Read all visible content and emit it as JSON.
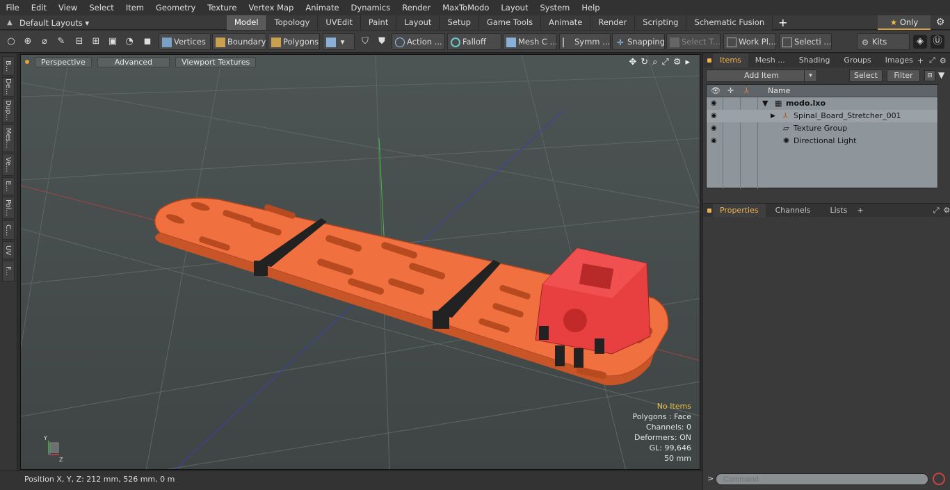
{
  "menu": [
    "File",
    "Edit",
    "View",
    "Select",
    "Item",
    "Geometry",
    "Texture",
    "Vertex Map",
    "Animate",
    "Dynamics",
    "Render",
    "MaxToModo",
    "Layout",
    "System",
    "Help"
  ],
  "layout": {
    "name": "Default Layouts",
    "tabs": [
      "Model",
      "Topology",
      "UVEdit",
      "Paint",
      "Layout",
      "Setup",
      "Game Tools",
      "Animate",
      "Render",
      "Scripting",
      "Schematic Fusion"
    ],
    "active_tab": "Model",
    "only_label": "Only"
  },
  "toolbar": {
    "vertices": "Vertices",
    "boundary": "Boundary",
    "polygons": "Polygons",
    "action": "Action",
    "falloff": "Falloff",
    "mesh": "Mesh C ...",
    "symm": "Symm ...",
    "snapping": "Snapping",
    "select_t": "Select T...",
    "workpl": "Work Pl...",
    "selecti": "Selecti ...",
    "kits": "Kits"
  },
  "left_tabs": [
    "B...",
    "De...",
    "Dup...",
    "Mes...",
    "Ve...",
    "E...",
    "Pol...",
    "C...",
    "UV",
    "F..."
  ],
  "viewport": {
    "perspective": "Perspective",
    "advanced": "Advanced",
    "textures": "Viewport Textures",
    "info": {
      "no_items": "No Items",
      "polygons": "Polygons : Face",
      "channels": "Channels: 0",
      "deformers": "Deformers: ON",
      "gl": "GL: 99,646",
      "scale": "50 mm"
    },
    "axis": {
      "y": "Y",
      "z": "Z"
    }
  },
  "status": {
    "position": "Position X, Y, Z:   212 mm, 526 mm, 0 m"
  },
  "items_panel": {
    "tabs": [
      "Items",
      "Mesh ...",
      "Shading",
      "Groups",
      "Images"
    ],
    "add_item": "Add Item",
    "select": "Select",
    "filter": "Filter",
    "name_col": "Name",
    "rows": [
      {
        "label": "modo.lxo"
      },
      {
        "label": "Spinal_Board_Stretcher_001"
      },
      {
        "label": "Texture Group"
      },
      {
        "label": "Directional Light"
      }
    ]
  },
  "props_panel": {
    "tabs": [
      "Properties",
      "Channels",
      "Lists"
    ]
  },
  "command": {
    "placeholder": "Command"
  }
}
